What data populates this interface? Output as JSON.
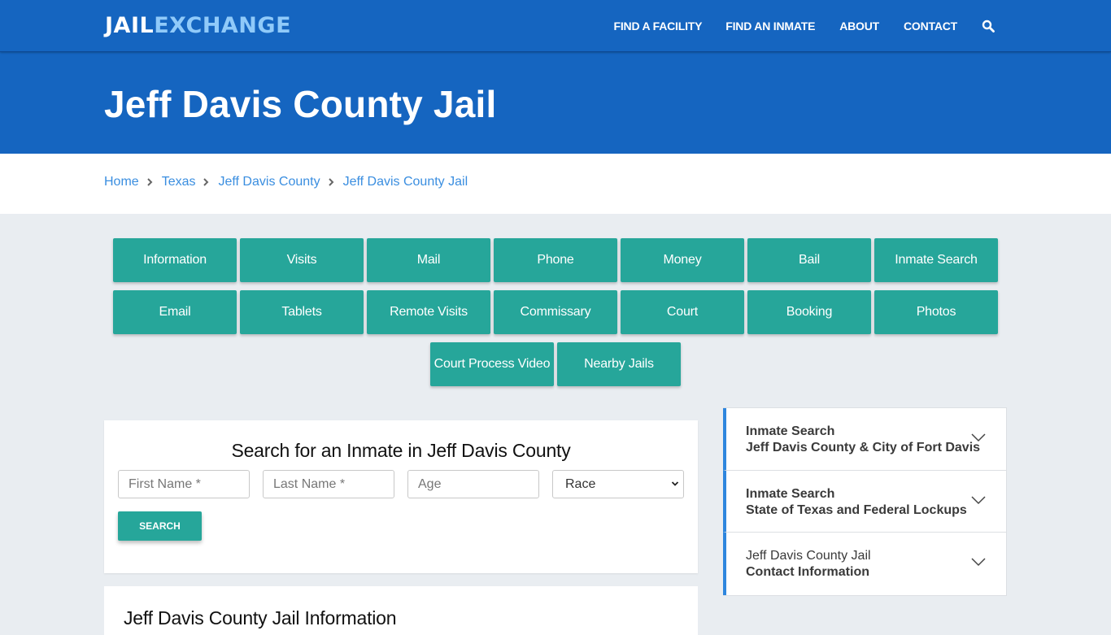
{
  "brand": {
    "part1": "JAIL",
    "part2": "EXCHANGE"
  },
  "nav": {
    "links": [
      "FIND A FACILITY",
      "FIND AN INMATE",
      "ABOUT",
      "CONTACT"
    ],
    "search_icon": "search-icon"
  },
  "hero": {
    "title": "Jeff Davis County Jail"
  },
  "breadcrumb": [
    "Home",
    "Texas",
    "Jeff Davis County",
    "Jeff Davis County Jail"
  ],
  "categories": [
    "Information",
    "Visits",
    "Mail",
    "Phone",
    "Money",
    "Bail",
    "Inmate Search",
    "Email",
    "Tablets",
    "Remote Visits",
    "Commissary",
    "Court",
    "Booking",
    "Photos",
    "Court Process Video",
    "Nearby Jails"
  ],
  "search": {
    "title": "Search for an Inmate in Jeff Davis County",
    "first_name_placeholder": "First Name *",
    "last_name_placeholder": "Last Name *",
    "age_placeholder": "Age",
    "race_selected": "Race",
    "button": "SEARCH"
  },
  "info": {
    "title": "Jeff Davis County Jail Information"
  },
  "accordion": [
    {
      "line1": "Inmate Search",
      "line2": "Jeff Davis County & City of Fort Davis",
      "line1_bold": true
    },
    {
      "line1": "Inmate Search",
      "line2": "State of Texas and Federal Lockups",
      "line1_bold": true
    },
    {
      "line1": "Jeff Davis County Jail",
      "line2": "Contact Information",
      "line1_bold": false
    }
  ],
  "colors": {
    "primary_blue": "#1565c0",
    "logo_accent": "#90caf9",
    "teal": "#26a69a",
    "link_blue": "#3a8ee0",
    "accordion_accent": "#2e86de",
    "page_bg": "#e9edf1"
  }
}
